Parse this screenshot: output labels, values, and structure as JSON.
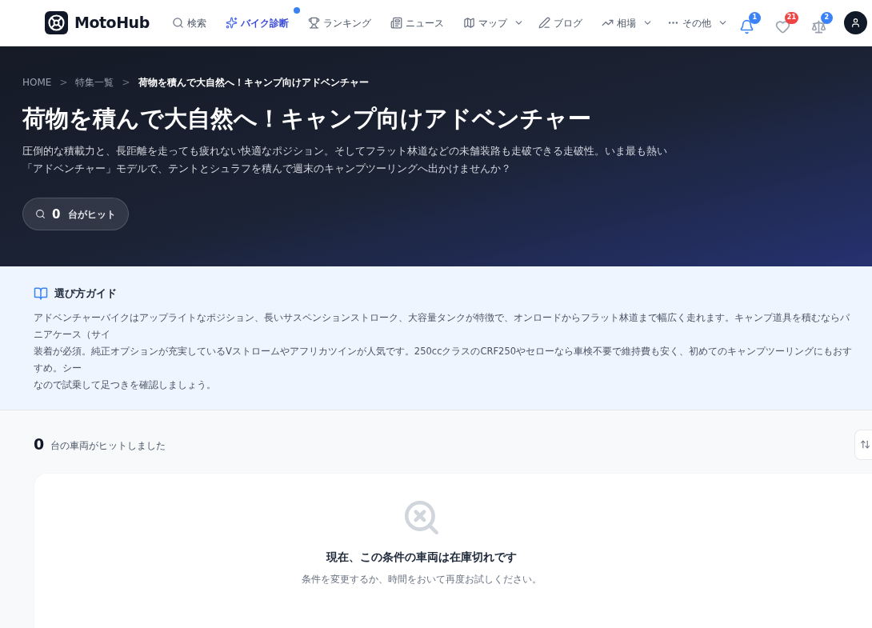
{
  "header": {
    "logo": "MotoHub",
    "nav": [
      {
        "kind": "search",
        "label": "検索",
        "selected": false,
        "dropdown": false,
        "dot": false
      },
      {
        "kind": "sparkles",
        "label": "バイク診断",
        "selected": true,
        "dropdown": false,
        "dot": true
      },
      {
        "kind": "trophy",
        "label": "ランキング",
        "selected": false,
        "dropdown": false,
        "dot": false
      },
      {
        "kind": "news",
        "label": "ニュース",
        "selected": false,
        "dropdown": false,
        "dot": false
      },
      {
        "kind": "map",
        "label": "マップ",
        "selected": false,
        "dropdown": true,
        "dot": false
      },
      {
        "kind": "pen",
        "label": "ブログ",
        "selected": false,
        "dropdown": false,
        "dot": false
      },
      {
        "kind": "trend",
        "label": "相場",
        "selected": false,
        "dropdown": true,
        "dot": false
      },
      {
        "kind": "more",
        "label": "その他",
        "selected": false,
        "dropdown": true,
        "dot": false
      }
    ],
    "actions": [
      {
        "kind": "bell",
        "badge": "1",
        "color": "#3b82f6",
        "selected": true
      },
      {
        "kind": "heart",
        "badge": "21",
        "color": "#ef4444",
        "selected": false
      },
      {
        "kind": "scale",
        "badge": "2",
        "color": "#3b82f6",
        "selected": false
      }
    ]
  },
  "hero": {
    "separator": ">",
    "breadcrumbs": [
      "HOME",
      "特集一覧",
      "荷物を積んで大自然へ！キャンプ向けアドベンチャー"
    ],
    "title": "荷物を積んで大自然へ！キャンプ向けアドベンチャー",
    "description": "圧倒的な積載力と、長距離を走っても疲れない快適なポジション。そしてフラット林道などの未舗装路も走破できる走破性。いま最も熱い「アドベンチャー」モデルで、テントとシュラフを積んで週末のキャンプツーリングへ出かけませんか？",
    "hit_count": "0",
    "hit_label": "台がヒット"
  },
  "guide": {
    "title": "選び方ガイド",
    "lines": [
      "アドベンチャーバイクはアップライトなポジション、長いサスペンションストローク、大容量タンクが特徴で、オンロードからフラット林道まで幅広く走れます。キャンプ道具を積むならパニアケース（サイ",
      "装着が必須。純正オプションが充実しているVストロームやアフリカツインが人気です。250ccクラスのCRF250やセローなら車検不要で維持費も安く、初めてのキャンプツーリングにもおすすめ。シー",
      "なので試乗して足つきを確認しましょう。"
    ]
  },
  "results": {
    "count": "0",
    "label": "台の車両がヒットしました",
    "empty_title": "現在、この条件の車両は在庫切れです",
    "empty_hint": "条件を変更するか、時間をおいて再度お試しください。"
  }
}
